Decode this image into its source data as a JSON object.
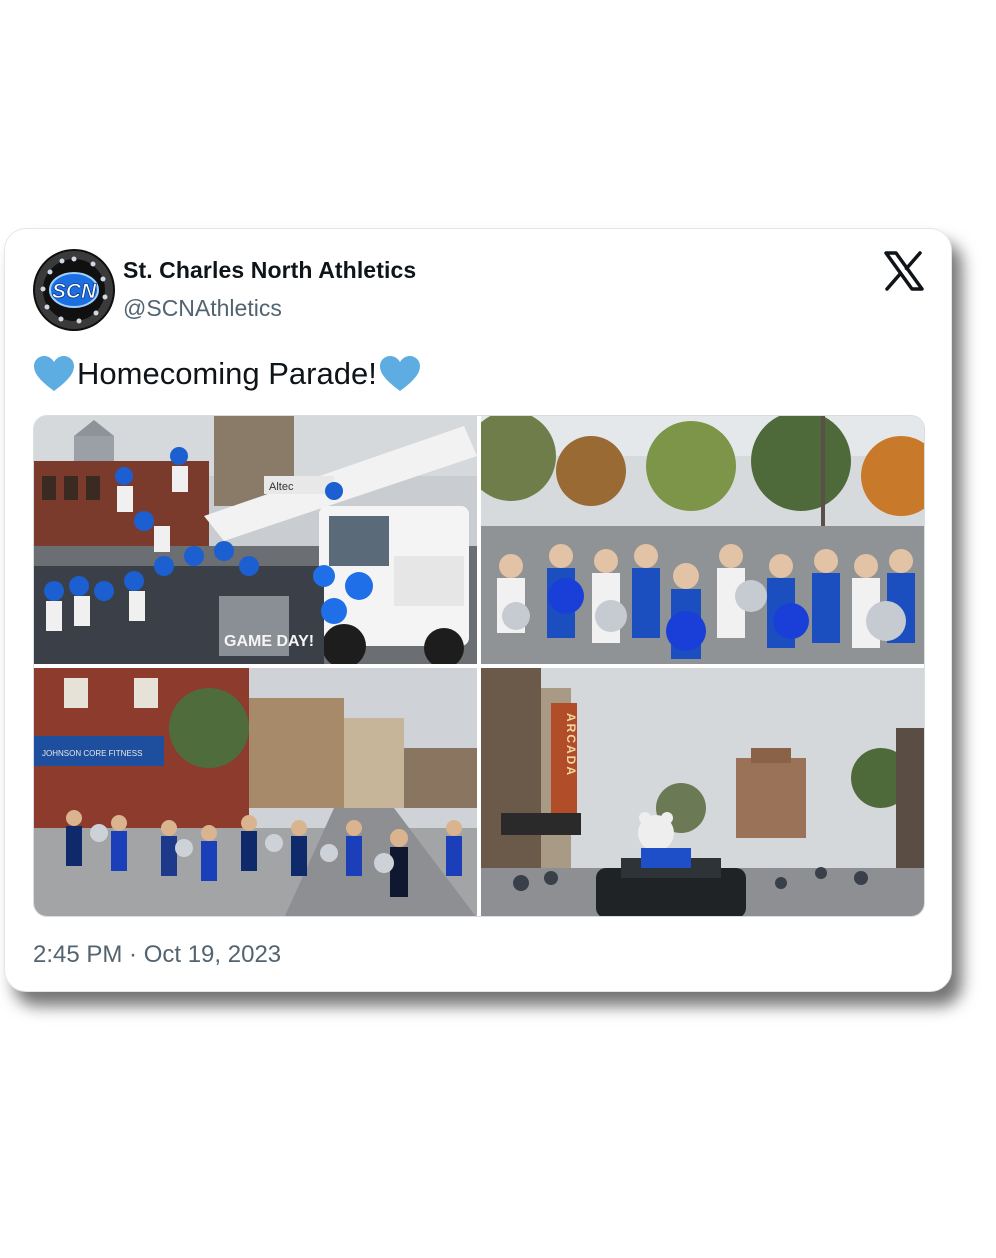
{
  "account": {
    "display_name": "St. Charles North Athletics",
    "handle": "@SCNAthletics",
    "avatar_text": "SCN"
  },
  "tweet": {
    "text": "Homecoming Parade!",
    "emoji_left": "blue-heart",
    "emoji_right": "blue-heart"
  },
  "photos": [
    {
      "icon": "parade-float-photo",
      "sign": "Altec",
      "banner": "GAME DAY!"
    },
    {
      "icon": "cheerleaders-group-photo"
    },
    {
      "icon": "marching-cheerleaders-photo",
      "storefront": "JOHNSON CORE FITNESS"
    },
    {
      "icon": "mascot-car-photo",
      "marquee": "ARCADA"
    }
  ],
  "footer": {
    "timestamp": "2:45 PM · Oct 19, 2023"
  },
  "colors": {
    "heart": "#5dade2",
    "brand_blue": "#1b62d6",
    "text_primary": "#0f1419",
    "text_secondary": "#536471"
  },
  "icons": {
    "platform": "x-logo-icon"
  }
}
